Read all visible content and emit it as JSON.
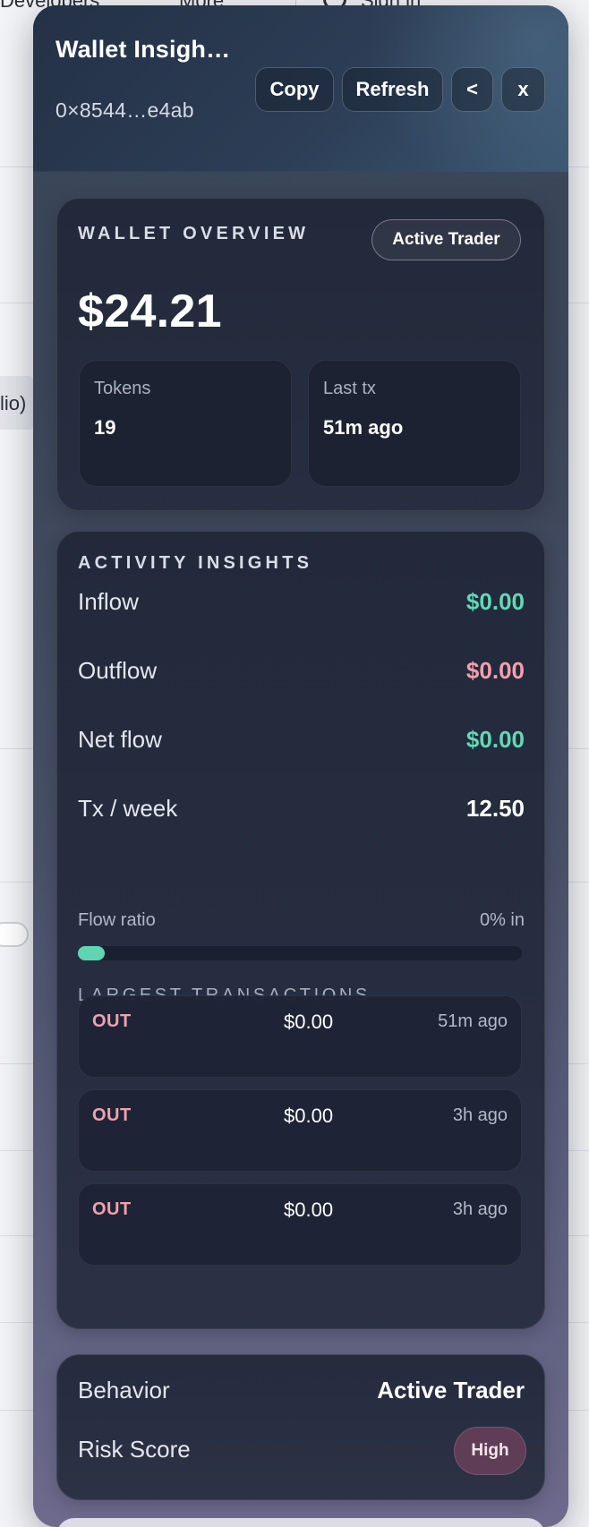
{
  "background": {
    "nav": [
      "Developers",
      "More",
      "Sign in"
    ],
    "pill_text": "lio)"
  },
  "header": {
    "title": "Wallet Insigh…",
    "address": "0×8544…e4ab",
    "buttons": {
      "copy": "Copy",
      "refresh": "Refresh",
      "back": "<",
      "close": "x"
    }
  },
  "overview": {
    "title": "WALLET OVERVIEW",
    "badge": "Active Trader",
    "balance": "$24.21",
    "tokens_label": "Tokens",
    "tokens_value": "19",
    "last_tx_label": "Last tx",
    "last_tx_value": "51m ago"
  },
  "activity": {
    "title": "ACTIVITY INSIGHTS",
    "rows": [
      {
        "label": "Inflow",
        "value": "$0.00",
        "color": "#63d8b4"
      },
      {
        "label": "Outflow",
        "value": "$0.00",
        "color": "#f0a1ad"
      },
      {
        "label": "Net flow",
        "value": "$0.00",
        "color": "#63d8b4"
      },
      {
        "label": "Tx / week",
        "value": "12.50",
        "color": "#ffffff"
      }
    ],
    "flow_ratio_label": "Flow ratio",
    "flow_ratio_value": "0% in",
    "flow_ratio_percent": 0,
    "largest_title": "LARGEST TRANSACTIONS",
    "transactions": [
      {
        "direction": "OUT",
        "amount": "$0.00",
        "time": "51m ago"
      },
      {
        "direction": "OUT",
        "amount": "$0.00",
        "time": "3h ago"
      },
      {
        "direction": "OUT",
        "amount": "$0.00",
        "time": "3h ago"
      }
    ]
  },
  "behavior": {
    "behavior_label": "Behavior",
    "behavior_value": "Active Trader",
    "risk_label": "Risk Score",
    "risk_value": "High"
  },
  "colors": {
    "accent_green": "#63d8b4",
    "accent_pink": "#f0a1ad",
    "risk_badge": "#68405a"
  }
}
